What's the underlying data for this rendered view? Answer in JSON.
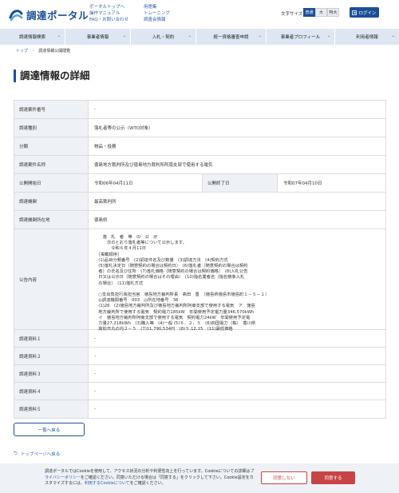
{
  "header": {
    "logo_text": "調達ポータル",
    "links_col1": [
      "ポータルトップへ",
      "操作マニュアル",
      "FAQ・お問い合わせ"
    ],
    "links_col2": [
      "用語集",
      "トレーニング",
      "調査会情報"
    ],
    "font_size_label": "文字サイズ",
    "font_sizes": [
      "普通",
      "大",
      "特大"
    ],
    "login_label": "ログイン",
    "brand_color": "#1d4f99"
  },
  "nav": {
    "items": [
      {
        "label": "調達情報検索"
      },
      {
        "label": "事業者情報"
      },
      {
        "label": "入札・契約"
      },
      {
        "label": "統一資格審査申請"
      },
      {
        "label": "事業者プロフィール"
      },
      {
        "label": "利用者情報"
      }
    ]
  },
  "breadcrumb": {
    "home": "トップ",
    "current": "調達情報公開閲覧"
  },
  "page_title": "調達情報の詳細",
  "detail": {
    "case_number_label": "調達案件番号",
    "case_number_value": "-",
    "type_label": "調達種別",
    "type_value": "落札者等の公示（WTO対象）",
    "category_label": "分類",
    "category_value": "物品・役務",
    "name_label": "調達案件名称",
    "name_value": "徳島地方裁判所及び徳島地方裁判所阿南支部で使用する電気",
    "start_label": "公開開始日",
    "start_value": "令和06年04月11日",
    "end_label": "公開終了日",
    "end_value": "令和07年04月10日",
    "org_label": "調達機関",
    "org_value": "最高裁判所",
    "location_label": "調達機関所在地",
    "location_value": "徳島県",
    "notice_label": "公告内容",
    "notice_value": "　　落　札　者　等　の　公　示\n　　　次のとおり落札者等について公示します。\n　　　　令和６年４月11日\n　［掲載順序］\n　(1)品目分類番号　(2)調達件名及び数量　(3)調達方法　(4)契約方式\n　(5)落札決定日（随意契約の場合は契約日）　(6)落札者（随意契約の場合は契約\n　者）の氏名及び住所　(7)落札価格（随意契約の場合は契約価格）　(8)入札公告\n　日又は公示日（随意契約の場合はその理由）　(10)指名業者名（指名競争入札\n　の場合）　(11)落札方式\n\n　○支出負担行為担当官　徳島地方裁判所長　髙田　豊　（徳島県徳島市徳島町１－５－１）\n　◎調達機関番号　003　◎所在地番号　36\n　(1)26　(2)徳島地方裁判所及び徳島地方裁判所阿南支部で使用する電気　ア　徳島\n　地方裁判所で使用する電気　契約電力185kW　年間使用予定電力量346,570kWh\n　イ　徳島地方裁判所阿南支部で使用する電気　契約電力24kW　年間使用予定電\n　力量27,218kWh　(3)購入等　(4)一般 (5)６．２．５　(6)四国電力（株）　香川県\n　高松市丸の内２－５　(7)11,790,534円　(8)５.12.15　(11)最低価格",
    "docs": [
      {
        "label": "調達資料１",
        "value": "-"
      },
      {
        "label": "調達資料２",
        "value": "-"
      },
      {
        "label": "調達資料３",
        "value": "-"
      },
      {
        "label": "調達資料４",
        "value": "-"
      },
      {
        "label": "調達資料５",
        "value": "-"
      }
    ]
  },
  "back_button_label": "一覧へ戻る",
  "to_top_label": "トップページへ戻る",
  "cookie": {
    "text_before": "調達ポータルではCookieを使用して、アクセス状況の分析や利便性向上を行っています。Cookieについての詳細は",
    "privacy_link": "プライバシーポリシー",
    "text_mid": "をご確認ください。同意いただける場合は「同意する」をクリックして下さい。Cookie設定をカスタマイズするには、",
    "settings_link": "利用するCookieについて",
    "text_after": "をご確認ください。",
    "deny_label": "同意しない",
    "accept_label": "同意する",
    "accent_color": "#c64444"
  }
}
